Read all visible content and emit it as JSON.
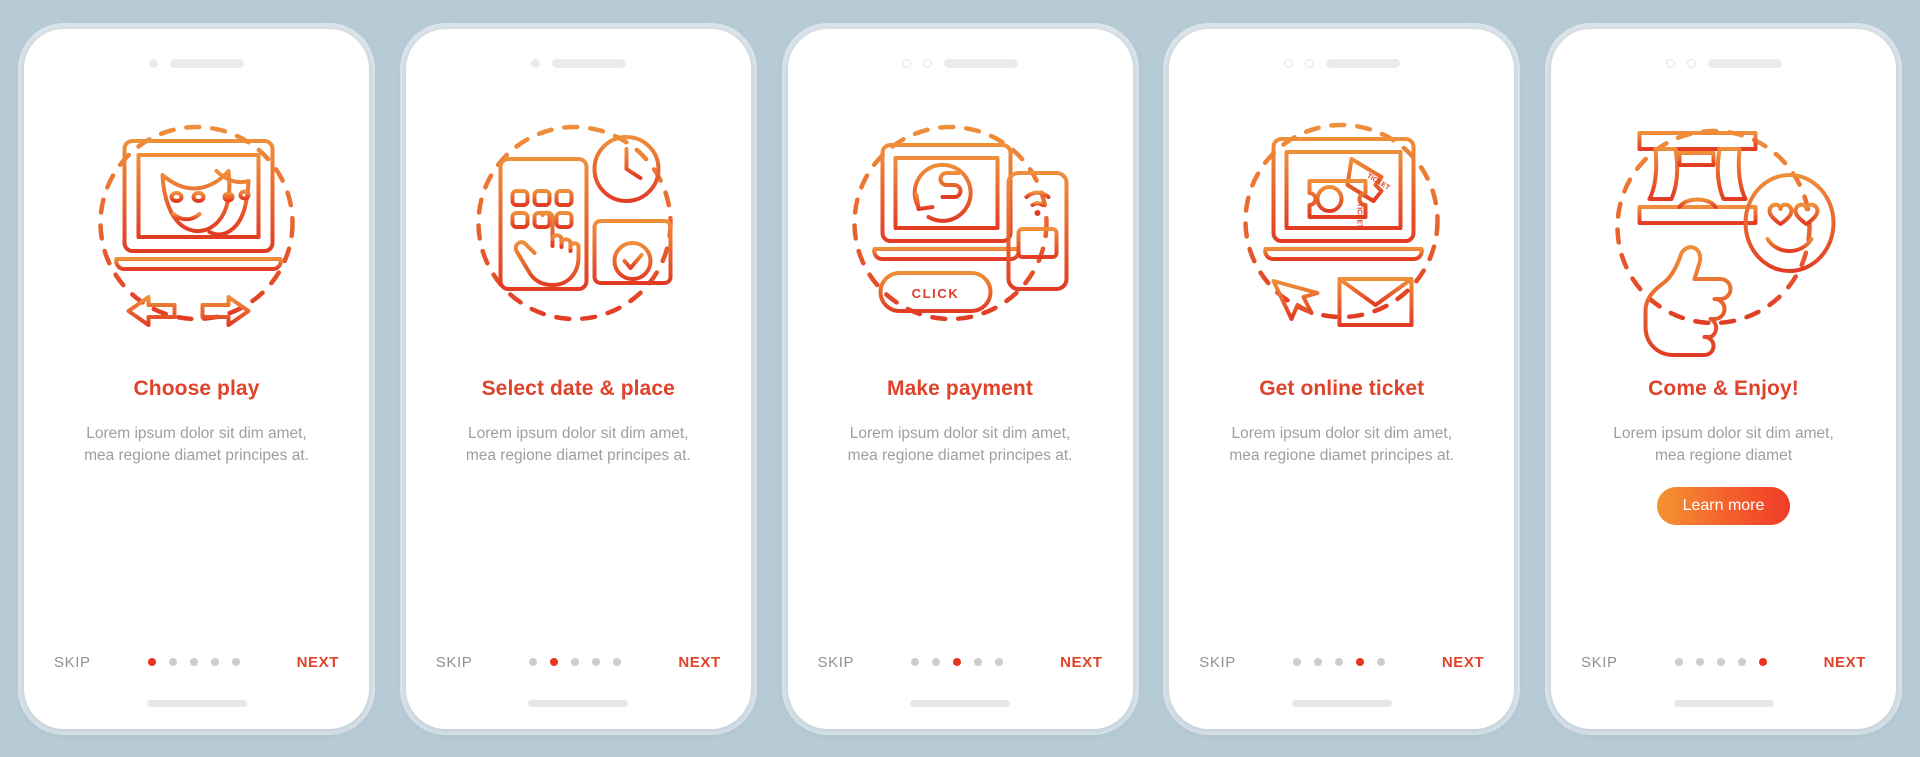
{
  "background_color": "#b7cbd6",
  "accent": {
    "title_color": "#e0422a",
    "body_color": "#9aa0a4",
    "dot_active": "#e8341f",
    "dot_inactive": "#c9ced1",
    "gradient_from": "#f59331",
    "gradient_to": "#ef3c28"
  },
  "common": {
    "skip_label": "SKIP",
    "next_label": "NEXT",
    "body_text": "Lorem ipsum dolor sit dim amet, mea regione diamet principes at.",
    "body_text_short": "Lorem ipsum dolor sit dim amet, mea regione diamet",
    "total_steps": 5
  },
  "screens": [
    {
      "title": "Choose play",
      "body": "Lorem ipsum dolor sit dim amet, mea regione diamet principes at.",
      "icon": "laptop-theater-masks-arrows-icon",
      "active_step": 1,
      "skip_label": "SKIP",
      "next_label": "NEXT",
      "notch": "single-camera"
    },
    {
      "title": "Select date & place",
      "body": "Lorem ipsum dolor sit dim amet, mea regione diamet principes at.",
      "icon": "calendar-clock-touch-icon",
      "active_step": 2,
      "skip_label": "SKIP",
      "next_label": "NEXT",
      "notch": "single-camera"
    },
    {
      "title": "Make payment",
      "body": "Lorem ipsum dolor sit dim amet, mea regione diamet principes at.",
      "icon": "laptop-dollar-phone-click-icon",
      "icon_label": "CLICK",
      "active_step": 3,
      "skip_label": "SKIP",
      "next_label": "NEXT",
      "notch": "dual-camera"
    },
    {
      "title": "Get online ticket",
      "body": "Lorem ipsum dolor sit dim amet, mea regione diamet principes at.",
      "icon": "laptop-tickets-envelope-cursor-icon",
      "icon_label": "TICKET",
      "active_step": 4,
      "skip_label": "SKIP",
      "next_label": "NEXT",
      "notch": "dual-camera"
    },
    {
      "title": "Come & Enjoy!",
      "body": "Lorem ipsum dolor sit dim amet, mea regione diamet",
      "icon": "stage-thumbsup-heart-eyes-icon",
      "cta_label": "Learn more",
      "active_step": 5,
      "skip_label": "SKIP",
      "next_label": "NEXT",
      "notch": "dual-camera"
    }
  ]
}
